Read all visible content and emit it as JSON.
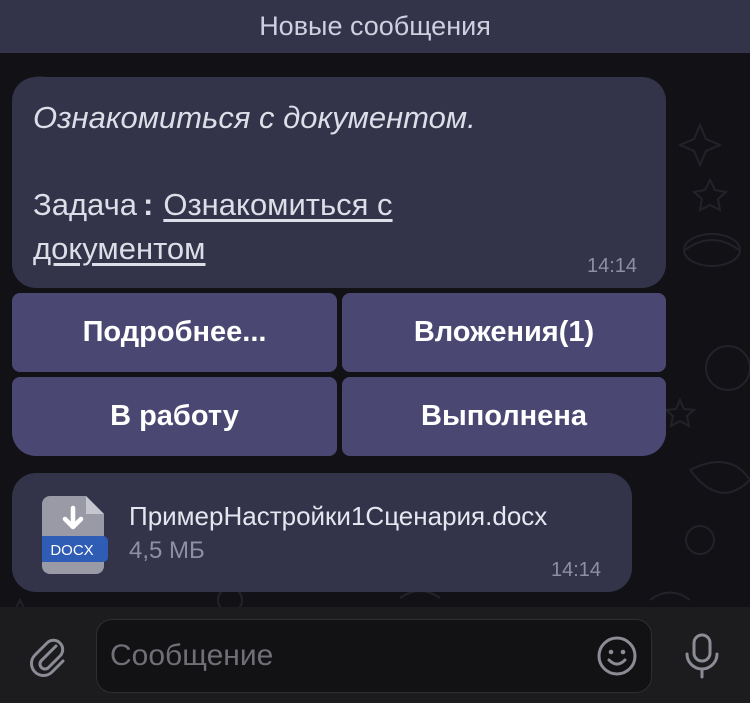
{
  "banner": {
    "text": "Новые сообщения"
  },
  "message": {
    "title": "Ознакомиться с документом.",
    "task_label": "Задача",
    "task_colon": ":",
    "task_link_part1": "Ознакомиться с",
    "task_link_part2": "документом",
    "time": "14:14"
  },
  "keyboard": {
    "buttons": [
      {
        "label": "Подробнее..."
      },
      {
        "label": "Вложения(1)"
      },
      {
        "label": "В работу"
      },
      {
        "label": "Выполнена"
      }
    ]
  },
  "file": {
    "name": "ПримерНастройки1Сценария.docx",
    "size": "4,5 МБ",
    "badge": "DOCX",
    "time": "14:14"
  },
  "composer": {
    "placeholder": "Сообщение"
  },
  "icons": {
    "attach": "paperclip-icon",
    "emoji": "emoji-icon",
    "mic": "microphone-icon",
    "download": "download-arrow-icon"
  },
  "colors": {
    "bubble": "#33334a",
    "button": "#4a4873",
    "chat_background": "#121216",
    "badge": "#2f5cb5"
  }
}
